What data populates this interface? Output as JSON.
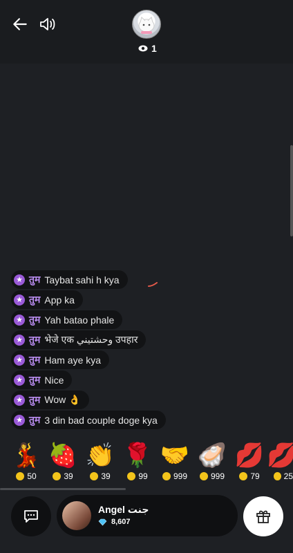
{
  "header": {
    "back_icon": "arrow-left-icon",
    "speaker_icon": "speaker-icon",
    "viewer_count": "1"
  },
  "chat": {
    "messages": [
      {
        "sender": "तुम",
        "text": "Taybat sahi h kya"
      },
      {
        "sender": "तुम",
        "text": "App ka"
      },
      {
        "sender": "तुम",
        "text": "Yah batao phale"
      },
      {
        "sender": "तुम",
        "text": "भेजे एक وحشتيني उपहार"
      },
      {
        "sender": "तुम",
        "text": "Ham aye kya"
      },
      {
        "sender": "तुम",
        "text": "Nice"
      },
      {
        "sender": "तुम",
        "text": "Wow 👌"
      },
      {
        "sender": "तुम",
        "text": "3 din bad couple doge kya"
      }
    ]
  },
  "gifts": [
    {
      "icon": "dancers-icon",
      "emoji": "💃",
      "price": "50"
    },
    {
      "icon": "strawberry-icon",
      "emoji": "🍓",
      "price": "39"
    },
    {
      "icon": "clapping-hands-icon",
      "emoji": "👏",
      "price": "39"
    },
    {
      "icon": "rose-icon",
      "emoji": "🌹",
      "price": "99"
    },
    {
      "icon": "handshake-icon",
      "emoji": "🤝",
      "price": "999"
    },
    {
      "icon": "pearl-shell-icon",
      "emoji": "🦪",
      "price": "999"
    },
    {
      "icon": "lips-icon",
      "emoji": "💋",
      "price": "79"
    },
    {
      "icon": "lips-icon",
      "emoji": "💋",
      "price": "25"
    }
  ],
  "footer": {
    "user_name": "Angel جنت",
    "diamonds": "8,607",
    "chat_icon": "chat-bubble-icon",
    "gift_icon": "gift-icon"
  },
  "colors": {
    "background": "#1e2024",
    "sender": "#b98cf0",
    "star_badge": "#9a5ad8",
    "coin": "#f3c41b",
    "diamond": "#4fc3f7"
  }
}
